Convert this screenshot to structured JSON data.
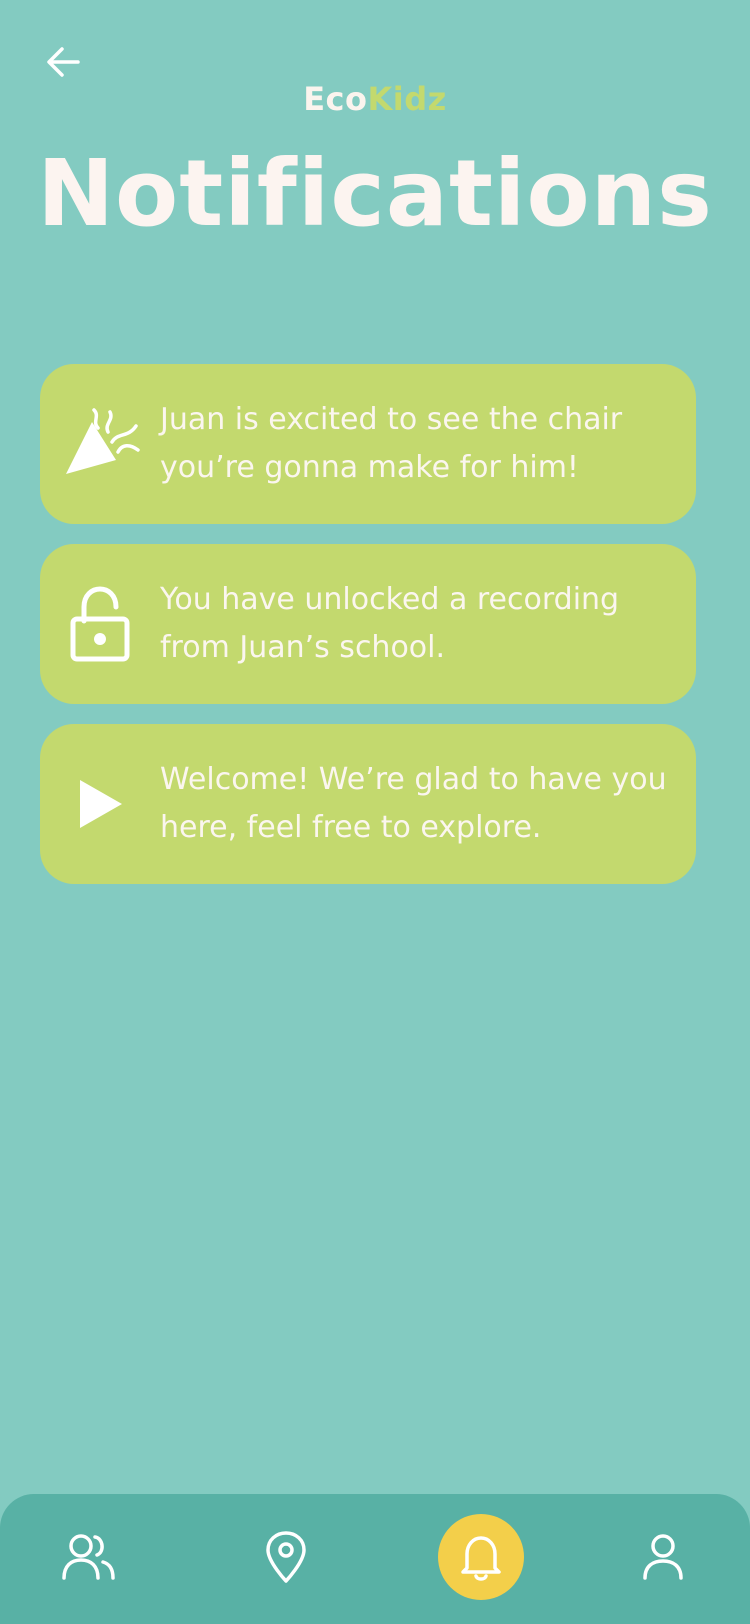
{
  "header": {
    "brand_part1": "Eco",
    "brand_part2": "Kidz",
    "title": "Notifications",
    "back_icon": "arrow-left-icon"
  },
  "notifications": [
    {
      "icon": "party-popper-icon",
      "text": "Juan is excited to see the chair you’re gonna make for him!"
    },
    {
      "icon": "unlock-icon",
      "text": "You have unlocked a recording from Juan’s school."
    },
    {
      "icon": "play-icon",
      "text": "Welcome! We’re glad to have you here, feel free to explore."
    }
  ],
  "bottom_nav": {
    "items": [
      {
        "icon": "users-icon",
        "active": false
      },
      {
        "icon": "map-pin-icon",
        "active": false
      },
      {
        "icon": "bell-icon",
        "active": true
      },
      {
        "icon": "user-icon",
        "active": false
      }
    ]
  },
  "colors": {
    "background": "#83cbc1",
    "card": "#c3d96e",
    "nav": "#58b1a5",
    "active": "#f3cf4a",
    "text_light": "#fbf6ef",
    "brand_accent": "#c3d96e"
  }
}
